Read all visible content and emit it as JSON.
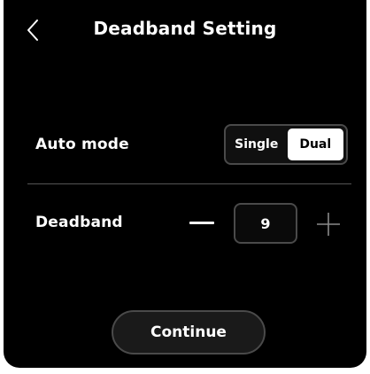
{
  "header": {
    "title": "Deadband Setting",
    "back_icon": "chevron-left-icon"
  },
  "auto_mode": {
    "label": "Auto mode",
    "options": [
      "Single",
      "Dual"
    ],
    "selected": "Dual"
  },
  "deadband": {
    "label": "Deadband",
    "value": "9",
    "decrement_icon": "minus-icon",
    "increment_icon": "plus-icon"
  },
  "footer": {
    "continue_label": "Continue"
  },
  "colors": {
    "background": "#000000",
    "text": "#ffffff",
    "border": "#4a4a4a",
    "selected_bg": "#ffffff",
    "selected_text": "#000000",
    "plus_icon": "#8a8a8a"
  }
}
